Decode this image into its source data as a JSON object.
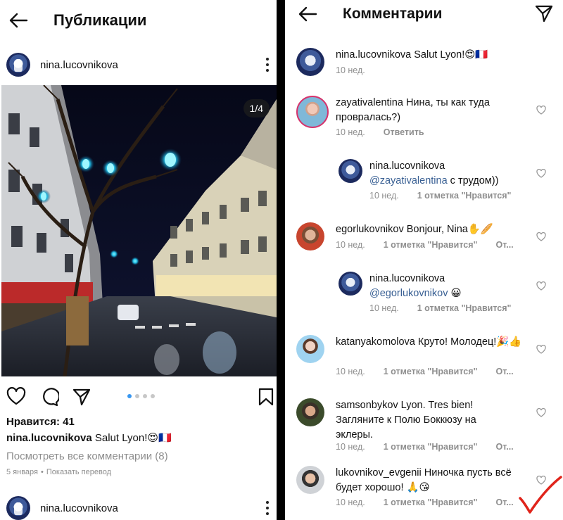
{
  "left": {
    "title": "Публикации",
    "post": {
      "username": "nina.lucovnikova",
      "counter": "1/4",
      "carousel_dots": 4,
      "carousel_active": 1,
      "likes": "Нравится: 41",
      "caption_user": "nina.lucovnikova",
      "caption_text": " Salut Lyon!😍🇫🇷",
      "view_all": "Посмотреть все комментарии (8)",
      "date": "5 января",
      "translate": "Показать перевод"
    },
    "next_post": {
      "username": "nina.lucovnikova"
    }
  },
  "right": {
    "title": "Комментарии",
    "comments": [
      {
        "user": "nina.lucovnikova",
        "text": " Salut Lyon!😍🇫🇷",
        "time": "10 нед."
      },
      {
        "user": "zayativalentina",
        "text": " Нина, ты как туда провралась?)",
        "time": "10 нед.",
        "reply": "Ответить"
      },
      {
        "user": "nina.lucovnikova",
        "mention": "@zayativalentina",
        "text": " с трудом))",
        "time": "10 нед.",
        "likes": "1 отметка \"Нравится\""
      },
      {
        "user": "egorlukovnikov",
        "text": " Bonjour, Nina✋🥖",
        "time": "10 нед.",
        "likes": "1 отметка \"Нравится\"",
        "reply": "От..."
      },
      {
        "user": "nina.lucovnikova",
        "mention": "@egorlukovnikov",
        "text": " 😀",
        "time": "10 нед.",
        "likes": "1 отметка \"Нравится\""
      },
      {
        "user": "katanyakomolova",
        "text": " Круто! Молодец!🎉👍",
        "time": "10 нед.",
        "likes": "1 отметка \"Нравится\"",
        "reply": "От..."
      },
      {
        "user": "samsonbykov",
        "text": " Lyon. Tres bien! Загляните к Полю Боккюзу на эклеры.",
        "time": "10 нед.",
        "likes": "1 отметка \"Нравится\"",
        "reply": "От..."
      },
      {
        "user": "lukovnikov_evgenii",
        "text": " Ниночка пусть всё будет хорошо! 🙏😘",
        "time": "10 нед.",
        "likes": "1 отметка \"Нравится\"",
        "reply": "От..."
      }
    ]
  },
  "colors": {
    "link": "#385f93",
    "muted": "#8e8e8e",
    "carousel_active": "#3897f0",
    "annotation": "#e0241b"
  },
  "icons": [
    "back-arrow-icon",
    "kebab-menu-icon",
    "heart-icon",
    "comment-icon",
    "share-icon",
    "bookmark-icon",
    "send-icon",
    "checkmark-annotation"
  ]
}
